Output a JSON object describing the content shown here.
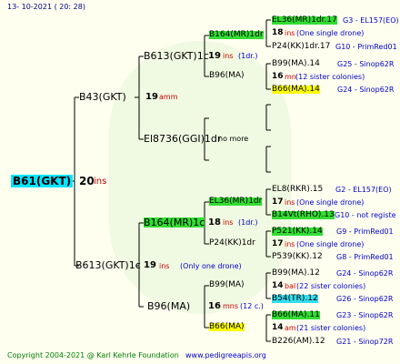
{
  "header": {
    "date": "13- 10-2021 ( 20: 28)"
  },
  "footer": {
    "copyright": "Copyright 2004-2021 @ Karl Kehrle Foundation",
    "url": "www.pedigreeapis.org"
  },
  "colors": {
    "green": "#33dd33",
    "cyan": "#33ddee",
    "yellow": "#ffff00",
    "root": "#00e5ff",
    "line": "#000000"
  },
  "root": {
    "name": "B61(GKT)",
    "num": "20",
    "suffix": "ins"
  },
  "g1": {
    "top": {
      "name": "B43(GKT)",
      "num": "19",
      "suffix": "amm"
    },
    "bottom": {
      "name": "B613(GKT)1c",
      "num": "19",
      "suffix": "ins",
      "note": "(Only one drone)"
    }
  },
  "g2": {
    "a": {
      "name": "B613(GKT)1c",
      "num": "19",
      "suffix": "ins",
      "note": "(1dr.)"
    },
    "b": {
      "name": "El8736(GGI)1dr",
      "note": "no more"
    },
    "c": {
      "name": "B164(MR)1c",
      "num": "18",
      "suffix": "ins",
      "note": "(1dr.)"
    },
    "d": {
      "name": "B96(MA)",
      "num": "16",
      "suffix": "mns",
      "note": "(12 c.)"
    }
  },
  "g3": {
    "a1": {
      "name": "B164(MR)1dr",
      "num": "18",
      "suffix": "ins",
      "note": "(One single drone)"
    },
    "a2": {
      "name": "B96(MA)",
      "num": "16",
      "suffix": "mn",
      "note": "(12 sister colonies)"
    },
    "c1": {
      "name": "EL36(MR)1dr",
      "num": "17",
      "suffix": "ins",
      "note": "(One single drone)"
    },
    "c2": {
      "name": "P24(KK)1dr",
      "num": "17",
      "suffix": "ins",
      "note": "(One single drone)"
    },
    "d1": {
      "name": "B99(MA)",
      "num": "14",
      "suffix": "bal",
      "note": "(22 sister colonies)"
    },
    "d2": {
      "name": "B66(MA)",
      "num": "14",
      "suffix": "am",
      "note": "(21 sister colonies)"
    }
  },
  "g4": [
    {
      "name": "EL36(MR)1dr.17",
      "ref": "G3 - EL157(EO)",
      "hl": "green"
    },
    {
      "name": "P24(KK)1dr.17",
      "ref": "G10 - PrimRed01",
      "hl": ""
    },
    {
      "name": "B99(MA).14",
      "ref": "G25 - Sinop62R",
      "hl": ""
    },
    {
      "name": "B66(MA).14",
      "ref": "G24 - Sinop62R",
      "hl": "yellow"
    },
    {
      "name": "EL8(RKR).15",
      "ref": "G2 - EL157(EO)",
      "hl": ""
    },
    {
      "name": "B14Vt(RHO).13",
      "ref": "G10 - not registe",
      "hl": "green"
    },
    {
      "name": "P521(KK).14",
      "ref": "G9 - PrimRed01",
      "hl": "green"
    },
    {
      "name": "P539(KK).12",
      "ref": "G8 - PrimRed01",
      "hl": ""
    },
    {
      "name": "B99(MA).12",
      "ref": "G24 - Sinop62R",
      "hl": ""
    },
    {
      "name": "B54(TR).12",
      "ref": "G26 - Sinop62R",
      "hl": "cyan"
    },
    {
      "name": "B66(MA).11",
      "ref": "G23 - Sinop62R",
      "hl": "green"
    },
    {
      "name": "B226(AM).12",
      "ref": "G21 - Sinop72R",
      "hl": ""
    }
  ],
  "g4_notes": [
    {
      "num": "18",
      "suffix": "ins",
      "note": "(One single drone)"
    },
    {
      "num": "16",
      "suffix": "mn",
      "note": "(12 sister colonies)"
    },
    {
      "num": "17",
      "suffix": "ins",
      "note": "(One single drone)"
    },
    {
      "num": "17",
      "suffix": "ins",
      "note": "(One single drone)"
    },
    {
      "num": "14",
      "suffix": "bal",
      "note": "(22 sister colonies)"
    },
    {
      "num": "14",
      "suffix": "am",
      "note": "(21 sister colonies)"
    }
  ]
}
